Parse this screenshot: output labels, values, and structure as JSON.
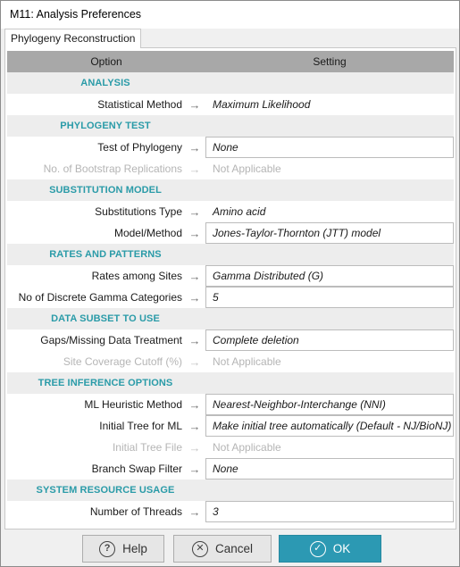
{
  "window": {
    "title": "M11: Analysis Preferences",
    "tab_label": "Phylogeny Reconstruction"
  },
  "grid": {
    "col_option": "Option",
    "col_setting": "Setting",
    "arrow": "→",
    "sections": [
      {
        "title": "ANALYSIS",
        "rows": [
          {
            "label": "Statistical Method",
            "value": "Maximum Likelihood",
            "enabled": true,
            "box": false
          }
        ]
      },
      {
        "title": "PHYLOGENY TEST",
        "rows": [
          {
            "label": "Test of Phylogeny",
            "value": "None",
            "enabled": true,
            "box": true
          },
          {
            "label": "No. of Bootstrap Replications",
            "value": "Not Applicable",
            "enabled": false,
            "box": false
          }
        ]
      },
      {
        "title": "SUBSTITUTION MODEL",
        "rows": [
          {
            "label": "Substitutions Type",
            "value": "Amino acid",
            "enabled": true,
            "box": false
          },
          {
            "label": "Model/Method",
            "value": "Jones-Taylor-Thornton (JTT) model",
            "enabled": true,
            "box": true
          }
        ]
      },
      {
        "title": "RATES AND PATTERNS",
        "rows": [
          {
            "label": "Rates among Sites",
            "value": "Gamma Distributed (G)",
            "enabled": true,
            "box": true
          },
          {
            "label": "No of Discrete Gamma Categories",
            "value": "5",
            "enabled": true,
            "box": true
          }
        ]
      },
      {
        "title": "DATA SUBSET TO USE",
        "rows": [
          {
            "label": "Gaps/Missing Data Treatment",
            "value": "Complete deletion",
            "enabled": true,
            "box": true
          },
          {
            "label": "Site Coverage Cutoff (%)",
            "value": "Not Applicable",
            "enabled": false,
            "box": false
          }
        ]
      },
      {
        "title": "TREE INFERENCE OPTIONS",
        "rows": [
          {
            "label": "ML Heuristic Method",
            "value": "Nearest-Neighbor-Interchange (NNI)",
            "enabled": true,
            "box": true
          },
          {
            "label": "Initial Tree for ML",
            "value": "Make initial tree automatically (Default - NJ/BioNJ)",
            "enabled": true,
            "box": true
          },
          {
            "label": "Initial Tree File",
            "value": "Not Applicable",
            "enabled": false,
            "box": false
          },
          {
            "label": "Branch Swap Filter",
            "value": "None",
            "enabled": true,
            "box": true
          }
        ]
      },
      {
        "title": "SYSTEM RESOURCE USAGE",
        "rows": [
          {
            "label": "Number of Threads",
            "value": "3",
            "enabled": true,
            "box": true
          }
        ]
      }
    ]
  },
  "buttons": {
    "help": "Help",
    "cancel": "Cancel",
    "ok": "OK"
  },
  "colors": {
    "section_title": "#2a9ba8",
    "ok_button": "#2c99b3",
    "header_bg": "#a8a8a8"
  }
}
